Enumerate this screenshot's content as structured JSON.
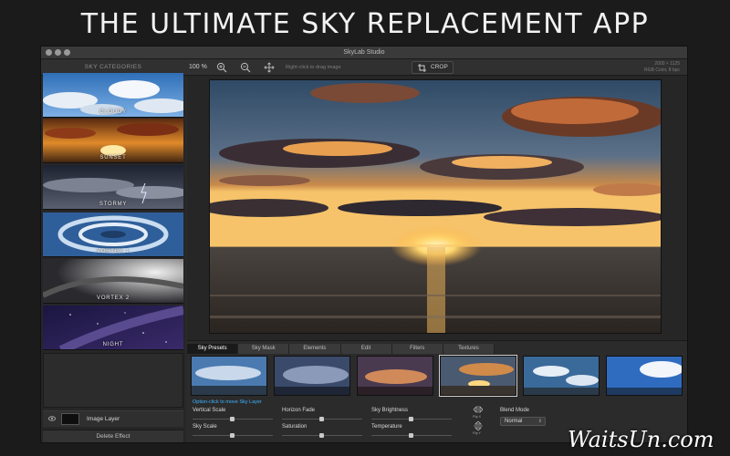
{
  "headline": "THE ULTIMATE SKY REPLACEMENT APP",
  "window": {
    "title": "SkyLab Studio"
  },
  "toolbar": {
    "categories_header": "SKY CATEGORIES",
    "zoom": "100 %",
    "hint": "Right-click to drag image",
    "crop_label": "CROP",
    "image_size": "2000 × 1125",
    "color_info": "RGB Color, 8 bpc"
  },
  "sidebar": {
    "categories": [
      {
        "label": "CLOUDY"
      },
      {
        "label": "SUNSET"
      },
      {
        "label": "STORMY"
      },
      {
        "label": "VORTEX 1"
      },
      {
        "label": "VORTEX 2"
      },
      {
        "label": "NIGHT"
      }
    ],
    "layer_label": "Image Layer",
    "delete_label": "Delete Effect"
  },
  "panel": {
    "tabs": [
      {
        "label": "Sky Presets",
        "active": true
      },
      {
        "label": "Sky Mask",
        "active": false
      },
      {
        "label": "Elements",
        "active": false
      },
      {
        "label": "Edit",
        "active": false
      },
      {
        "label": "Filters",
        "active": false
      },
      {
        "label": "Textures",
        "active": false
      }
    ],
    "option_hint": "Option-click to move Sky Layer",
    "controls": {
      "vertical_scale": "Vertical Scale",
      "horizon_fade": "Horizon Fade",
      "sky_brightness": "Sky Brightness",
      "sky_scale": "Sky Scale",
      "saturation": "Saturation",
      "temperature": "Temperature"
    },
    "flip_x": "Flip X",
    "flip_y": "Flip Y",
    "blend_mode_label": "Blend Mode",
    "blend_mode_value": "Normal"
  },
  "watermark": "WaitsUn.com",
  "icons": {
    "zoom_in": "zoom-in-icon",
    "zoom_out": "zoom-out-icon",
    "move": "move-icon",
    "crop": "crop-icon",
    "eye": "eye-icon",
    "flip_x": "flip-x-icon",
    "flip_y": "flip-y-icon"
  },
  "colors": {
    "accent_hint": "#3fb7ff",
    "background": "#1b1b1c",
    "panel": "#2b2b2c"
  }
}
